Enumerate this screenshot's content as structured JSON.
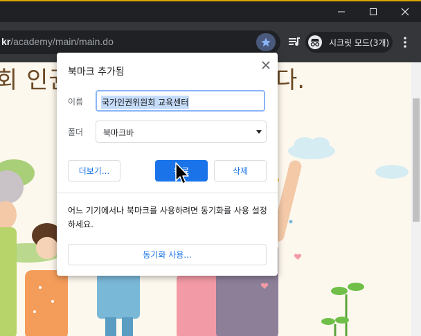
{
  "window": {
    "controls": {
      "minimize_icon": "minimize-icon",
      "maximize_icon": "maximize-icon",
      "close_icon": "close-icon"
    }
  },
  "toolbar": {
    "url_host_fragment": "kr",
    "url_path": "/academy/main/main.do",
    "incognito_label": "시크릿 모드(3개)",
    "accent_color": "#8ab4f8"
  },
  "page": {
    "heading_left": "회 인권",
    "heading_right": "다."
  },
  "dialog": {
    "title": "북마크 추가됨",
    "name_label": "이름",
    "name_value": "국가인권위원회 교육센터",
    "folder_label": "폴더",
    "folder_value": "북마크바",
    "more_button": "더보기...",
    "done_button": "완료",
    "delete_button": "삭제",
    "sync_message": "어느 기기에서나 북마크를 사용하려면 동기화를 사용 설정하세요.",
    "sync_button": "동기화 사용...",
    "primary_color": "#1a73e8"
  }
}
